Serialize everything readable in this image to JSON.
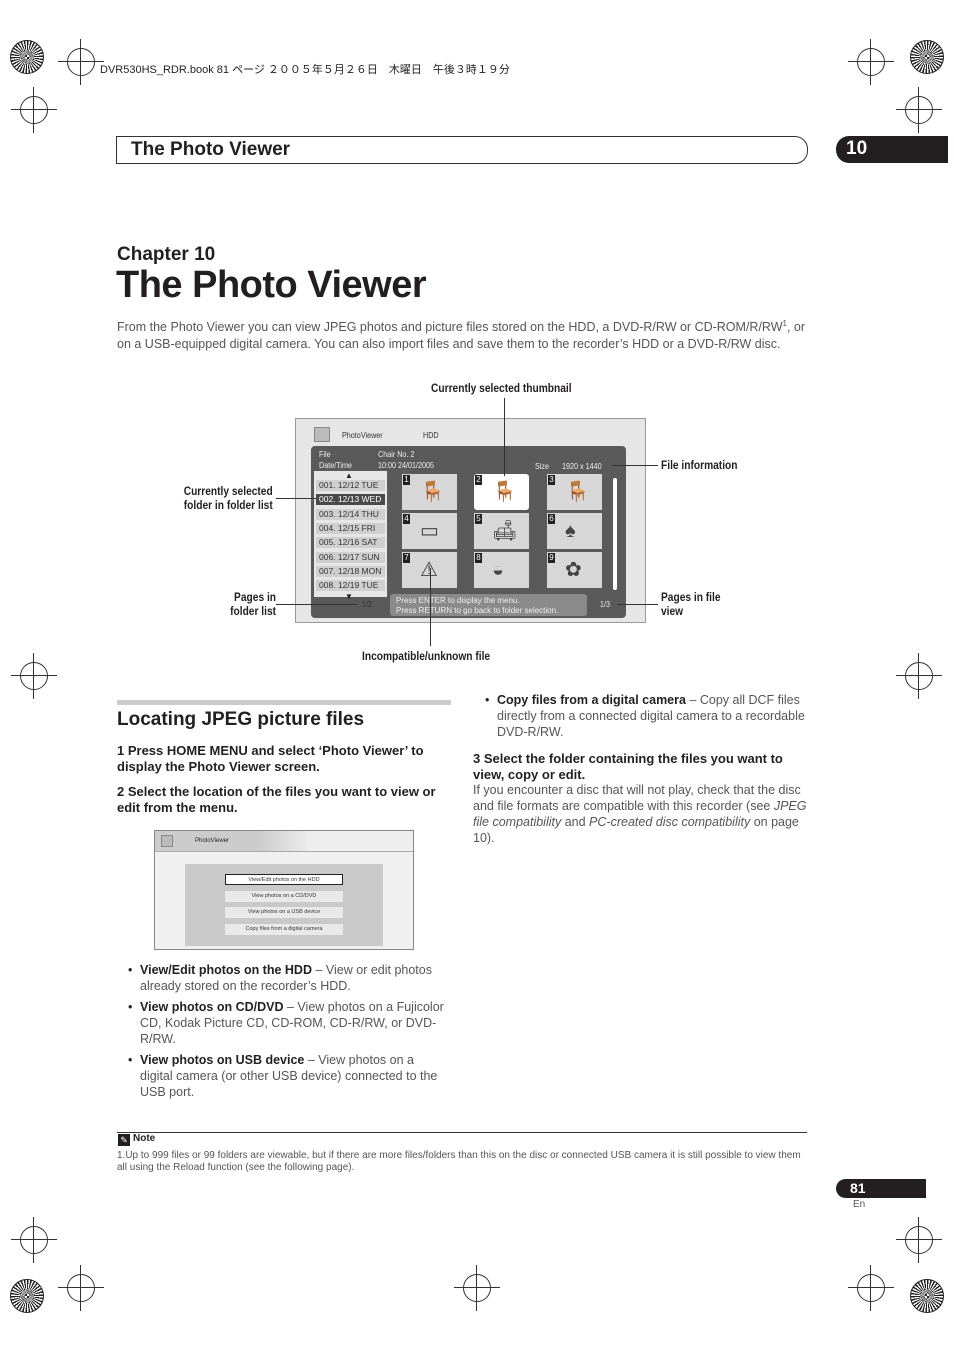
{
  "print_header": "DVR530HS_RDR.book  81 ページ  ２００５年５月２６日　木曜日　午後３時１９分",
  "running_header": {
    "title": "The Photo Viewer",
    "chapter_number": "10"
  },
  "chapter_label": "Chapter 10",
  "page_title": "The Photo Viewer",
  "intro": {
    "text_before": "From the Photo Viewer you can view JPEG photos and picture files stored on the HDD, a DVD-R/RW or CD-ROM/R/RW",
    "sup": "1",
    "text_after": ", or on a USB-equipped digital camera. You can also import files and save them to the recorder’s HDD or a DVD-R/RW disc."
  },
  "diagram": {
    "callouts": {
      "thumbnail": "Currently selected thumbnail",
      "file_info": "File information",
      "folder_1": "Currently selected",
      "folder_2": "folder in folder list",
      "pages_folder_1": "Pages in",
      "pages_folder_2": "folder list",
      "pages_file_1": "Pages in file",
      "pages_file_2": "view",
      "incompatible": "Incompatible/unknown file"
    },
    "screen": {
      "app": "PhotoViewer",
      "source": "HDD",
      "file_label": "File",
      "file_value": "Chair No. 2",
      "date_label": "Date/Time",
      "date_value": "10:00 24/01/2005",
      "size_label": "Size",
      "size_value": "1920 x 1440",
      "folders": [
        "001. 12/12 TUE",
        "002. 12/13 WED",
        "003. 12/14 THU",
        "004. 12/15 FRI",
        "005. 12/16 SAT",
        "006. 12/17 SUN",
        "007. 12/18 MON",
        "008. 12/19 TUE"
      ],
      "selected_folder": 1,
      "thumbnails": [
        "1",
        "2",
        "3",
        "4",
        "5",
        "6",
        "7",
        "8",
        "9"
      ],
      "selected_thumbnail": 1,
      "folder_pages": "1/2",
      "file_pages": "1/3",
      "msg1": "Press ENTER to display the menu.",
      "msg2": "Press RETURN to go back to folder selection."
    }
  },
  "section_title": "Locating JPEG picture files",
  "steps": {
    "s1": "1    Press HOME MENU and select ‘Photo Viewer’ to display the Photo Viewer screen.",
    "s2": "2    Select the location of the files you want to view or edit from the menu.",
    "s3": "3    Select the folder containing the files you want to view, copy or edit."
  },
  "menu": {
    "title": "PhotoViewer",
    "items": [
      "View/Edit photos on the HDD",
      "View photos on a CD/DVD",
      "View photos on a USB device",
      "Copy files from a digital camera"
    ]
  },
  "bullets": [
    {
      "term": "View/Edit photos on the HDD",
      "desc": " – View or edit photos already stored on the recorder’s HDD."
    },
    {
      "term": "View photos on CD/DVD",
      "desc": " – View photos on a Fujicolor CD, Kodak Picture CD, CD-ROM, CD-R/RW, or DVD-R/RW."
    },
    {
      "term": "View photos on USB device",
      "desc": " – View photos on a digital camera (or other USB device) connected to the USB port."
    },
    {
      "term": "Copy files from a digital camera",
      "desc": " – Copy all DCF files directly from a connected digital camera to a recordable DVD-R/RW."
    }
  ],
  "step3_body": {
    "a": "If you encounter a disc that will not play, check that the disc and file formats are compatible with this recorder (see ",
    "i1": "JPEG file compatibility",
    "b": " and ",
    "i2": "PC-created disc compatibility",
    "c": " on page 10)."
  },
  "note": {
    "label": "Note",
    "text": "1.Up to 999 files or 99 folders are viewable, but if there are more files/folders than this on the disc or connected USB camera it is still possible to view them all using the Reload function (see the following page)."
  },
  "page_number": "81",
  "language": "En"
}
